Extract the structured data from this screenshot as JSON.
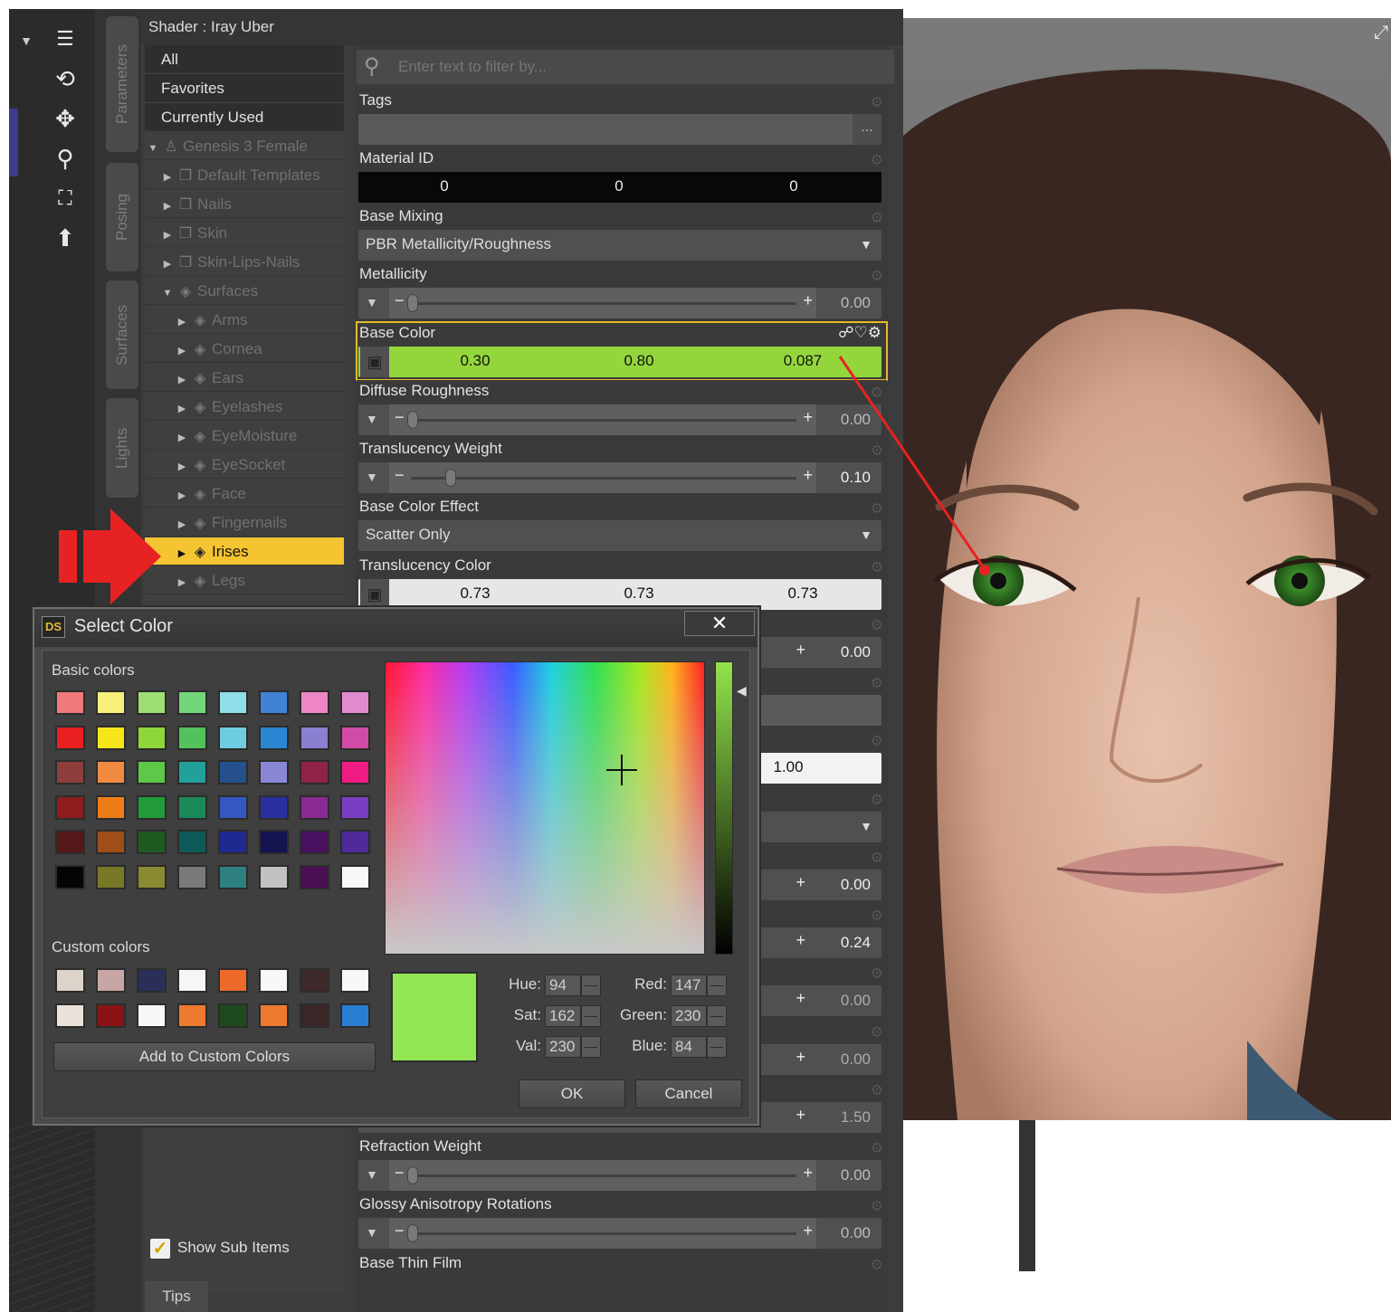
{
  "toolbar": {
    "icons": [
      "dropdown-arrow-icon",
      "list-icon",
      "orbit-icon",
      "move-icon",
      "zoom-icon",
      "frame-icon",
      "reset-view-icon"
    ]
  },
  "vertical_tabs": [
    "Parameters",
    "Posing",
    "Surfaces",
    "Lights"
  ],
  "shader_panel": {
    "title": "Shader : Iray Uber",
    "tree": {
      "top_items": [
        "All",
        "Favorites",
        "Currently Used"
      ],
      "figure": "Genesis 3 Female",
      "groups": [
        "Default Templates",
        "Nails",
        "Skin",
        "Skin-Lips-Nails"
      ],
      "surfaces_label": "Surfaces",
      "surfaces": [
        "Arms",
        "Cornea",
        "Ears",
        "Eyelashes",
        "EyeMoisture",
        "EyeSocket",
        "Face",
        "Fingernails",
        "Irises",
        "Legs"
      ],
      "selected": "Irises"
    },
    "show_sub_items_label": "Show Sub Items",
    "tips_label": "Tips",
    "filter_placeholder": "Enter text to filter by...",
    "properties": {
      "tags": {
        "label": "Tags",
        "button": "..."
      },
      "material_id": {
        "label": "Material ID",
        "values": [
          "0",
          "0",
          "0"
        ]
      },
      "base_mixing": {
        "label": "Base Mixing",
        "value": "PBR Metallicity/Roughness"
      },
      "metallicity": {
        "label": "Metallicity",
        "value": "0.00",
        "fraction": 0.0
      },
      "base_color": {
        "label": "Base Color",
        "values": [
          "0.30",
          "0.80",
          "0.087"
        ],
        "color": "#93d63c"
      },
      "diffuse_roughness": {
        "label": "Diffuse Roughness",
        "value": "0.00",
        "fraction": 0.0
      },
      "translucency_weight": {
        "label": "Translucency Weight",
        "value": "0.10",
        "fraction": 0.1
      },
      "base_color_effect": {
        "label": "Base Color Effect",
        "value": "Scatter Only"
      },
      "translucency_color": {
        "label": "Translucency Color",
        "values": [
          "0.73",
          "0.73",
          "0.73"
        ]
      },
      "hidden_values": [
        "0.00",
        "1.00",
        "0.00",
        "0.24",
        "0.00",
        "0.00",
        "1.50"
      ],
      "refraction_weight": {
        "label": "Refraction Weight",
        "value": "0.00",
        "fraction": 0.0
      },
      "glossy_anisotropy_rotations": {
        "label": "Glossy Anisotropy Rotations",
        "value": "0.00",
        "fraction": 0.0
      },
      "base_thin_film": {
        "label": "Base Thin Film"
      }
    }
  },
  "select_color_dialog": {
    "title": "Select Color",
    "logo": "DS",
    "close": "✕",
    "basic_colors_label": "Basic colors",
    "custom_colors_label": "Custom colors",
    "add_custom_label": "Add to Custom Colors",
    "hue_label": "Hue:",
    "hue": "94",
    "sat_label": "Sat:",
    "sat": "162",
    "val_label": "Val:",
    "val": "230",
    "red_label": "Red:",
    "red": "147",
    "green_label": "Green:",
    "green": "230",
    "blue_label": "Blue:",
    "blue": "84",
    "ok_label": "OK",
    "cancel_label": "Cancel",
    "preview_color": "#93e654",
    "basic_colors": [
      [
        "#f07a7a",
        "#f8ee7a",
        "#9ede74",
        "#74d67a",
        "#8edde8",
        "#3f82d6",
        "#ee86c6",
        "#e08ad0"
      ],
      [
        "#e82020",
        "#f5e61a",
        "#8fd63a",
        "#52c25a",
        "#6ecce0",
        "#2a86d2",
        "#8a80d2",
        "#d04aa6"
      ],
      [
        "#8e3c3c",
        "#f08a40",
        "#5ec848",
        "#22a09a",
        "#24508e",
        "#8a86d6",
        "#902248",
        "#f01c84"
      ],
      [
        "#8e1c1c",
        "#f07c18",
        "#229a3a",
        "#1a8a5a",
        "#3458c2",
        "#2a30a2",
        "#8a2a92",
        "#7a3ec2"
      ],
      [
        "#541818",
        "#a04e18",
        "#1e5a20",
        "#0e5a58",
        "#1e2a90",
        "#141450",
        "#4a1060",
        "#4e2a9a"
      ],
      [
        "#050505",
        "#787826",
        "#8a8a32",
        "#7a7a7a",
        "#2e8080",
        "#c2c2c2",
        "#4a0e52",
        "#f8f8f8"
      ]
    ],
    "custom_colors": [
      [
        "#dcd4ca",
        "#c8a6a6",
        "#2c2e5a",
        "#f6f6f6",
        "#ee6a2a",
        "#f8f8f8",
        "#3e2a2a",
        "#f8f8f8"
      ],
      [
        "#e8e2da",
        "#8a1414",
        "#f8f8f8",
        "#ee7a30",
        "#1e4a1e",
        "#ee7a30",
        "#3a2626",
        "#2a7ed2"
      ]
    ]
  }
}
